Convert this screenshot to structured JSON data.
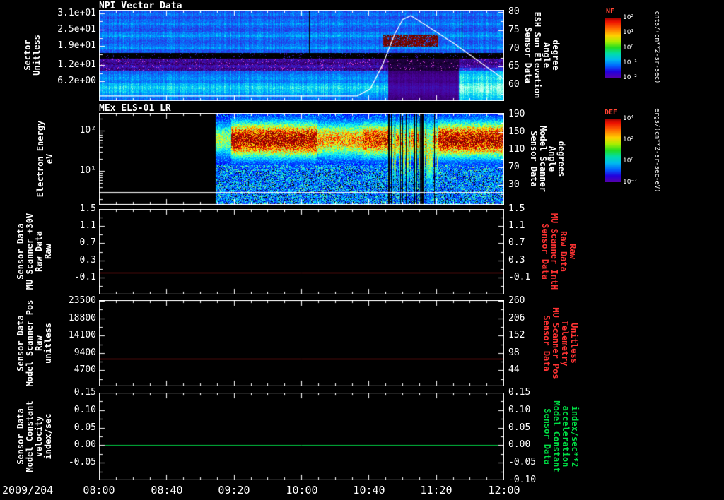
{
  "background": "#000000",
  "text_color": "#ffffff",
  "x_axis": {
    "date": "2009/204",
    "tick_labels": [
      "08:00",
      "08:40",
      "09:20",
      "10:00",
      "10:40",
      "11:20",
      "12:00"
    ],
    "hours": [
      8,
      8.6667,
      9.3333,
      10,
      10.6667,
      11.3333,
      12
    ],
    "range": [
      8,
      12
    ]
  },
  "chart_data": [
    {
      "type": "heatmap",
      "title": "NPI Vector Data",
      "ylabel_lines": [
        "Sector",
        "Unitless"
      ],
      "left_axis": {
        "ylim": [
          32.2,
          -1
        ],
        "ticks": [
          31,
          25,
          19,
          12,
          6.2
        ],
        "labels": [
          "3.1e+01",
          "2.5e+01",
          "1.9e+01",
          "1.2e+01",
          "6.2e+00"
        ]
      },
      "right_axis": {
        "label_lines": [
          "Sensor Data",
          "ESH Sun Elevation",
          "Angle",
          "degree"
        ],
        "ylim": [
          80.6,
          55.6
        ],
        "ticks": [
          80,
          75,
          70,
          65,
          60
        ],
        "labels": [
          "80",
          "75",
          "70",
          "65",
          "60"
        ]
      },
      "colorbar": {
        "label": "NF",
        "units": "cnts/(cm**2-sr-sec)",
        "tick_labels": [
          "10²",
          "10¹",
          "10⁰",
          "10⁻¹",
          "10⁻²"
        ]
      },
      "overlay_line": {
        "name": "ESH Sun Elevation Angle",
        "color": "#ffffff",
        "points": [
          [
            8,
            57
          ],
          [
            10.55,
            57
          ],
          [
            10.68,
            59
          ],
          [
            10.8,
            65.5
          ],
          [
            10.92,
            74
          ],
          [
            11.0,
            78
          ],
          [
            11.08,
            79
          ],
          [
            11.25,
            76
          ],
          [
            11.5,
            71.5
          ],
          [
            12,
            61.5
          ]
        ]
      },
      "sectors": 30,
      "rows": [
        0.46,
        0.52,
        0.44,
        0.5,
        0.58,
        0.48,
        0.44,
        0.55,
        0.62,
        0.5,
        0.46,
        0.52,
        0.6,
        0.46,
        0.02,
        0.02,
        0.2,
        0.16,
        0.24,
        0.18,
        0.48,
        0.55,
        0.6,
        0.55,
        0.68,
        0.76,
        0.7,
        0.62,
        0.56,
        0.5
      ],
      "features": {
        "disturb": {
          "t0": 10.85,
          "t1": 11.55,
          "rows": [
            16,
            29
          ]
        },
        "bright": {
          "t0": 11.55,
          "rows": [
            19,
            29
          ]
        },
        "red_patch": {
          "t0": 10.8,
          "t1": 11.35,
          "rows": [
            8,
            11
          ]
        }
      }
    },
    {
      "type": "heatmap",
      "title": "MEx ELS-01 LR",
      "ylabel_lines": [
        "Electron Energy",
        "eV"
      ],
      "left_axis": {
        "log": true,
        "ylim": [
          2.44,
          0.16
        ],
        "ticks": [
          2,
          1
        ],
        "labels": [
          "10²",
          "10¹"
        ]
      },
      "right_axis": {
        "label_lines": [
          "Sensor Data",
          "Model Scanner",
          "Angle",
          "degrees"
        ],
        "ylim": [
          193.2,
          -14.8
        ],
        "ticks": [
          190,
          150,
          110,
          70,
          30
        ],
        "labels": [
          "190",
          "150",
          "110",
          "70",
          "30"
        ]
      },
      "colorbar": {
        "label": "DEF",
        "units": "ergs/(cm**2-sr-sec-eV)",
        "tick_labels": [
          "10⁴",
          "10²",
          "10⁰",
          "10⁻²"
        ]
      },
      "white_line_energy_log": 0.47,
      "spec": {
        "t_start": 9.15,
        "band_center": 1.78,
        "band_sigma": 0.3,
        "segments": [
          [
            9.15,
            9.3,
            0.5
          ],
          [
            9.3,
            10.15,
            0.97
          ],
          [
            10.15,
            10.6,
            0.7
          ],
          [
            10.6,
            10.85,
            0.85
          ],
          [
            10.85,
            11.35,
            -1
          ],
          [
            11.35,
            12.01,
            0.97
          ]
        ]
      }
    },
    {
      "type": "line",
      "left_label_lines": [
        "Sensor Data",
        "MU Scanner +30V",
        "Raw Data",
        "Raw"
      ],
      "left_axis": {
        "ylim": [
          1.5,
          -0.5
        ],
        "ticks": [
          1.5,
          1.1,
          0.7,
          0.3,
          -0.1
        ],
        "labels": [
          "1.5",
          "1.1",
          "0.7",
          "0.3",
          "-0.1"
        ]
      },
      "right_axis": {
        "label_lines": [
          "Sensor Data",
          "MU Scanner IntH",
          "Raw Data",
          "Raw"
        ],
        "color": "#ff3333",
        "ylim": [
          1.5,
          -0.5
        ],
        "ticks": [
          1.5,
          1.1,
          0.7,
          0.3,
          -0.1
        ],
        "labels": [
          "1.5",
          "1.1",
          "0.7",
          "0.3",
          "-0.1"
        ]
      },
      "series": [
        {
          "name": "MU Scanner +30V Raw",
          "color": "#ff2222",
          "value": 0.02
        }
      ]
    },
    {
      "type": "line",
      "left_label_lines": [
        "Sensor Data",
        "Model Scanner Pos",
        "Raw",
        "unitless"
      ],
      "left_axis": {
        "ylim": [
          23700,
          380
        ],
        "ticks": [
          23500,
          18800,
          14100,
          9400,
          4700
        ],
        "labels": [
          "23500",
          "18800",
          "14100",
          "9400",
          "4700"
        ]
      },
      "right_axis": {
        "label_lines": [
          "Sensor Data",
          "MU Scanner Pos",
          "Telemetry",
          "Unitless"
        ],
        "color": "#ff3333",
        "ylim": [
          262.2,
          -5.6
        ],
        "ticks": [
          260,
          206,
          152,
          98,
          44
        ],
        "labels": [
          "260",
          "206",
          "152",
          "98",
          "44"
        ]
      },
      "series": [
        {
          "name": "Model Scanner Pos Raw",
          "color": "#ff2222",
          "value": 7800
        }
      ]
    },
    {
      "type": "line",
      "left_label_lines": [
        "Sensor Data",
        "Model Constant",
        "velocity",
        "index/sec"
      ],
      "left_axis": {
        "ylim": [
          0.15,
          -0.1
        ],
        "ticks": [
          0.15,
          0.1,
          0.05,
          0,
          -0.05
        ],
        "labels": [
          "0.15",
          "0.10",
          "0.05",
          "0.00",
          "-0.05"
        ]
      },
      "right_axis": {
        "label_lines": [
          "Sensor Data",
          "Model Constant",
          "acceleration",
          "index/sec**2"
        ],
        "color": "#00dd44",
        "ylim": [
          0.15,
          -0.1
        ],
        "ticks": [
          0.15,
          0.1,
          0.05,
          0,
          -0.05,
          -0.1
        ],
        "labels": [
          "0.15",
          "0.10",
          "0.05",
          "0.00",
          "-0.05",
          "-0.10"
        ]
      },
      "series": [
        {
          "name": "Model Constant velocity",
          "color": "#00cc44",
          "value": 0
        }
      ]
    }
  ]
}
